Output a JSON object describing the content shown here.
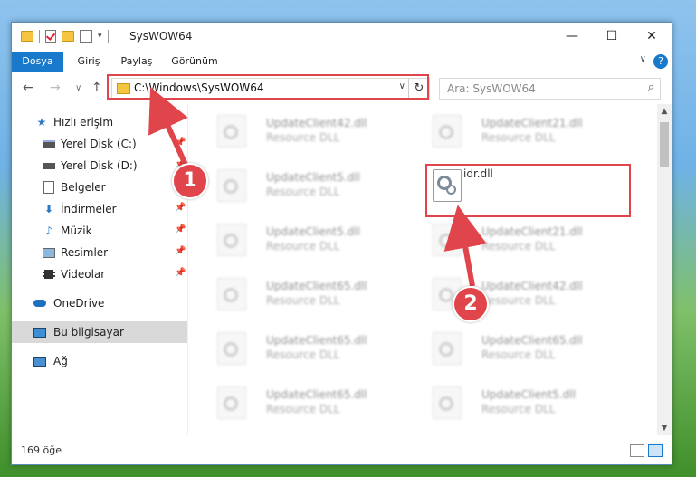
{
  "window": {
    "title": "SysWOW64",
    "minimize": "—",
    "maximize": "☐",
    "close": "✕"
  },
  "ribbon": {
    "tabs": [
      "Dosya",
      "Giriş",
      "Paylaş",
      "Görünüm"
    ],
    "help": "?"
  },
  "nav": {
    "back": "←",
    "forward": "→",
    "up": "↑",
    "address": "C:\\Windows\\SysWOW64",
    "refresh": "↻",
    "search_placeholder": "Ara: SysWOW64"
  },
  "sidebar": {
    "items": [
      {
        "label": "Hızlı erişim",
        "icon": "star-icon"
      },
      {
        "label": "Yerel Disk (C:)",
        "icon": "drive-icon"
      },
      {
        "label": "Yerel Disk (D:)",
        "icon": "drive-icon"
      },
      {
        "label": "Belgeler",
        "icon": "documents-icon"
      },
      {
        "label": "İndirmeler",
        "icon": "download-icon"
      },
      {
        "label": "Müzik",
        "icon": "music-icon"
      },
      {
        "label": "Resimler",
        "icon": "pictures-icon"
      },
      {
        "label": "Videolar",
        "icon": "videos-icon"
      },
      {
        "label": "OneDrive",
        "icon": "cloud-icon"
      },
      {
        "label": "Bu bilgisayar",
        "icon": "computer-icon"
      },
      {
        "label": "Ağ",
        "icon": "network-icon"
      }
    ]
  },
  "files": [
    {
      "name": "UpdateClient42.dll",
      "type": "Resource DLL"
    },
    {
      "name": "UpdateClient21.dll",
      "type": "Resource DLL"
    },
    {
      "name": "UpdateClient5.dll",
      "type": "Resource DLL"
    },
    {
      "name": "idr.dll",
      "type": ""
    },
    {
      "name": "UpdateClient5.dll",
      "type": "Resource DLL"
    },
    {
      "name": "UpdateClient21.dll",
      "type": "Resource DLL"
    },
    {
      "name": "UpdateClient65.dll",
      "type": "Resource DLL"
    },
    {
      "name": "UpdateClient42.dll",
      "type": "Resource DLL"
    },
    {
      "name": "UpdateClient65.dll",
      "type": "Resource DLL"
    },
    {
      "name": "UpdateClient65.dll",
      "type": "Resource DLL"
    },
    {
      "name": "UpdateClient65.dll",
      "type": "Resource DLL"
    },
    {
      "name": "UpdateClient5.dll",
      "type": "Resource DLL"
    }
  ],
  "status": {
    "count": "169 öğe"
  },
  "annotations": {
    "step1": "1",
    "step2": "2",
    "color": "#e0454b"
  }
}
